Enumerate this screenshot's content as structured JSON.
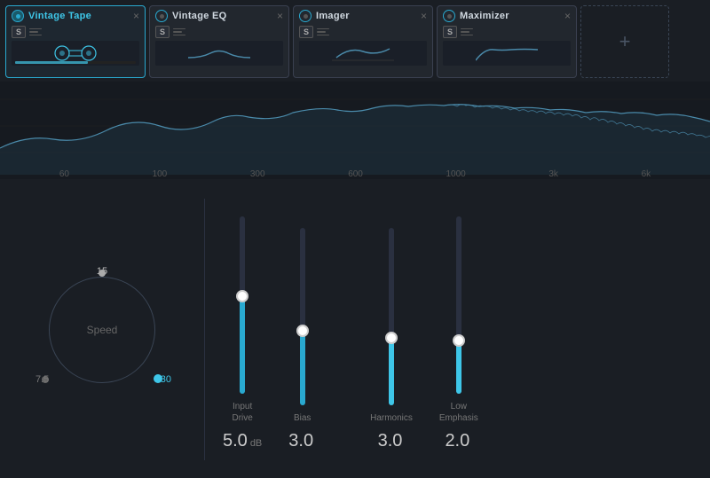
{
  "tabs": [
    {
      "id": "vintage-tape",
      "label": "Vintage Tape",
      "active": true,
      "close": "×"
    },
    {
      "id": "vintage-eq",
      "label": "Vintage EQ",
      "active": false,
      "close": "×"
    },
    {
      "id": "imager",
      "label": "Imager",
      "active": false,
      "close": "×"
    },
    {
      "id": "maximizer",
      "label": "Maximizer",
      "active": false,
      "close": "×"
    }
  ],
  "add_plugin_label": "+",
  "spectrum": {
    "labels": [
      "60",
      "100",
      "300",
      "600",
      "1000",
      "3k",
      "6k"
    ]
  },
  "knob": {
    "label": "Speed",
    "value_top": "15",
    "value_left": "7.5",
    "value_right": "30"
  },
  "sliders": [
    {
      "id": "input-drive",
      "label": "Input\nDrive",
      "value": "5.0",
      "unit": "dB",
      "fill_percent": 55,
      "thumb_percent": 55,
      "color": "blue"
    },
    {
      "id": "bias",
      "label": "Bias",
      "value": "3.0",
      "unit": "",
      "fill_percent": 42,
      "thumb_percent": 42,
      "color": "blue"
    },
    {
      "id": "harmonics",
      "label": "Harmonics",
      "value": "3.0",
      "unit": "",
      "fill_percent": 38,
      "thumb_percent": 38,
      "color": "cyan"
    },
    {
      "id": "low-emphasis",
      "label": "Low\nEmphasis",
      "value": "2.0",
      "unit": "",
      "fill_percent": 30,
      "thumb_percent": 30,
      "color": "cyan"
    }
  ],
  "colors": {
    "accent": "#29a9d0",
    "accent_bright": "#3ec6e8",
    "bg_dark": "#1a1e24",
    "bg_mid": "#22272e",
    "border": "#3a4050"
  }
}
